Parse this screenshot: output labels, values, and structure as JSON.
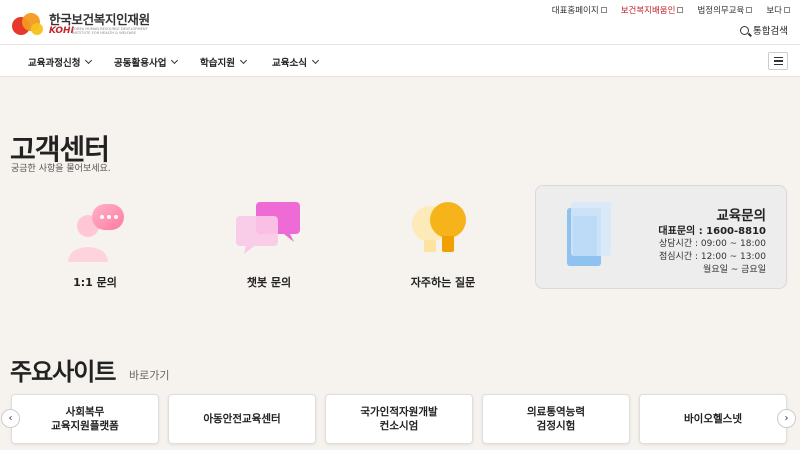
{
  "header": {
    "logo_name": "한국보건복지인재원",
    "logo_abbr": "KOHI",
    "logo_sub": "KOREA HUMAN RESOURCE DEVELOPMENT INSTITUTE FOR HEALTH & WELFARE",
    "util_links": [
      {
        "label": "대표홈페이지",
        "color": "#333333"
      },
      {
        "label": "보건복지배움인",
        "color": "#c0262d"
      },
      {
        "label": "법정의무교육",
        "color": "#333333"
      },
      {
        "label": "보다",
        "color": "#333333"
      }
    ],
    "search_label": "통합검색"
  },
  "gnb": {
    "items": [
      {
        "label": "교육과정신청"
      },
      {
        "label": "공동활용사업"
      },
      {
        "label": "학습지원"
      },
      {
        "label": "교육소식"
      }
    ]
  },
  "main": {
    "title": "고객센터",
    "description": "궁금한 사항을 물어보세요.",
    "services": [
      {
        "label": "1:1 문의",
        "icon": "person-chat-icon"
      },
      {
        "label": "챗봇 문의",
        "icon": "chatbot-bubbles-icon"
      },
      {
        "label": "자주하는 질문",
        "icon": "lightbulb-icon"
      }
    ],
    "contact": {
      "title": "교육문의",
      "phone": "대표문의 : 1600-8810",
      "consult_hours": "상담시간 : 09:00 ~ 18:00",
      "lunch_hours": "점심시간 : 12:00 ~ 13:00",
      "days": "월요일 ~ 금요일"
    }
  },
  "sites": {
    "title": "주요사이트",
    "subtitle": "바로가기",
    "items": [
      {
        "line1": "사회복무",
        "line2": "교육지원플랫폼"
      },
      {
        "line1": "아동안전교육센터",
        "line2": ""
      },
      {
        "line1": "국가인적자원개발",
        "line2": "컨소시엄"
      },
      {
        "line1": "의료통역능력",
        "line2": "검정시험"
      },
      {
        "line1": "바이오헬스넷",
        "line2": ""
      }
    ],
    "prev_glyph": "‹",
    "next_glyph": "›"
  },
  "colors": {
    "background": "#f6f3ee",
    "accent_red": "#c0262d",
    "accent_orange": "#f5a623"
  }
}
